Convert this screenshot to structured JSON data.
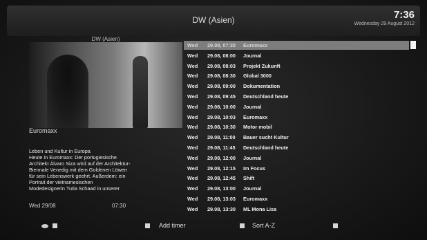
{
  "header": {
    "channel_title": "DW (Asien)",
    "time": "7:36",
    "date": "Wednesday 29 August 2012"
  },
  "preview": {
    "channel_label": "DW (Asien)"
  },
  "program": {
    "title": "Euromaxx",
    "description": "Leben und Kultur in Europa\nHeute in Euromaxx: Der portugiesische\nArchitekt Álvaro Siza wird auf der Architektur-\nBiennale Venedig mit dem Goldenen Löwen\nfür sein Lebenswerk geehrt. Außerdem: ein\nPortrait der vietnamesischen\nModedesignerin Tutia Schaad in unserer",
    "day_date": "Wed 29/08",
    "time": "07:30"
  },
  "epg": {
    "items": [
      {
        "day": "Wed",
        "date_time": "29.08, 07:30",
        "title": "Euromaxx"
      },
      {
        "day": "Wed",
        "date_time": "29.08, 08:00",
        "title": "Journal"
      },
      {
        "day": "Wed",
        "date_time": "29.08, 08:03",
        "title": "Projekt Zukunft"
      },
      {
        "day": "Wed",
        "date_time": "29.08, 08:30",
        "title": "Global 3000"
      },
      {
        "day": "Wed",
        "date_time": "29.08, 09:00",
        "title": "Dokumentation"
      },
      {
        "day": "Wed",
        "date_time": "29.08, 09:45",
        "title": "Deutschland heute"
      },
      {
        "day": "Wed",
        "date_time": "29.08, 10:00",
        "title": "Journal"
      },
      {
        "day": "Wed",
        "date_time": "29.08, 10:03",
        "title": "Euromaxx"
      },
      {
        "day": "Wed",
        "date_time": "29.08, 10:30",
        "title": "Motor mobil"
      },
      {
        "day": "Wed",
        "date_time": "29.08, 11:00",
        "title": "Bauer sucht Kultur"
      },
      {
        "day": "Wed",
        "date_time": "29.08, 11:45",
        "title": "Deutschland heute"
      },
      {
        "day": "Wed",
        "date_time": "29.08, 12:00",
        "title": "Journal"
      },
      {
        "day": "Wed",
        "date_time": "29.08, 12:15",
        "title": "Im Focus"
      },
      {
        "day": "Wed",
        "date_time": "29.08, 12:45",
        "title": "Shift"
      },
      {
        "day": "Wed",
        "date_time": "29.08, 13:00",
        "title": "Journal"
      },
      {
        "day": "Wed",
        "date_time": "29.08, 13:03",
        "title": "Euromaxx"
      },
      {
        "day": "Wed",
        "date_time": "29.08, 13:30",
        "title": "ML Mona Lisa"
      }
    ],
    "selected_index": 0
  },
  "footer": {
    "add_timer_label": "Add timer",
    "sort_label": "Sort A-Z"
  },
  "icons": {
    "info": "tv-info-icon",
    "red_key": "red-key-icon",
    "green_key": "green-key-icon",
    "blue_key": "blue-key-icon"
  }
}
